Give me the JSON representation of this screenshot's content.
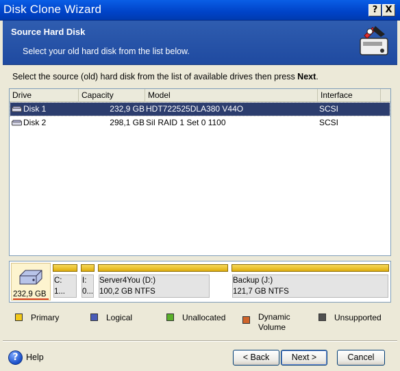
{
  "window": {
    "title": "Disk Clone Wizard",
    "help_button": "?",
    "close_button": "X"
  },
  "header": {
    "title": "Source Hard Disk",
    "subtitle": "Select your old hard disk from the list below."
  },
  "instruction": {
    "text": "Select the source (old) hard disk from the list of available drives then press ",
    "bold": "Next",
    "end": "."
  },
  "table": {
    "columns": [
      "Drive",
      "Capacity",
      "Model",
      "Interface"
    ],
    "rows": [
      {
        "drive": "Disk 1",
        "capacity": "232,9 GB",
        "model": "HDT722525DLA380 V44O",
        "interface": "SCSI",
        "selected": true
      },
      {
        "drive": "Disk 2",
        "capacity": "298,1 GB",
        "model": "SiI RAID 1 Set 0 1100",
        "interface": "SCSI",
        "selected": false
      }
    ]
  },
  "disk_map": {
    "disk_size": "232,9 GB",
    "partitions": [
      {
        "line1": "C:",
        "line2": "1..."
      },
      {
        "line1": "I:",
        "line2": "0..."
      },
      {
        "line1": "Server4You (D:)",
        "line2": "100,2 GB  NTFS"
      },
      {
        "line1": "Backup (J:)",
        "line2": "121,7 GB  NTFS"
      }
    ]
  },
  "legend": [
    {
      "label": "Primary",
      "color": "#f2c81a"
    },
    {
      "label": "Logical",
      "color": "#4a5cb8"
    },
    {
      "label": "Unallocated",
      "color": "#5ab02a"
    },
    {
      "label": "Dynamic",
      "label2": "Volume",
      "color": "#d0642a"
    },
    {
      "label": "Unsupported",
      "color": "#505050"
    }
  ],
  "footer": {
    "help": "Help",
    "back": "< Back",
    "next": "Next >",
    "cancel": "Cancel"
  }
}
